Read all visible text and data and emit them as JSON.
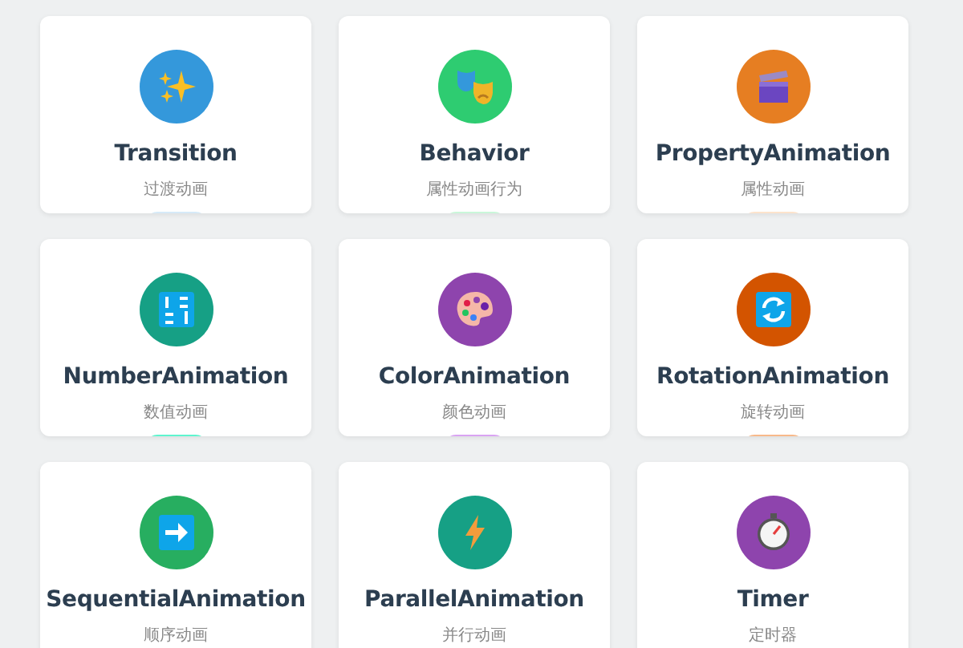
{
  "cards": [
    {
      "kind": "sparkles",
      "color": "#3498db",
      "title": "Transition",
      "subtitle": "过渡动画",
      "tag": {
        "color": "#d6eaf8"
      }
    },
    {
      "kind": "masks",
      "color": "#2ecc71",
      "title": "Behavior",
      "subtitle": "属性动画行为",
      "tag": {
        "color": "#c9f7d9"
      }
    },
    {
      "kind": "clapper",
      "color": "#e67e22",
      "title": "PropertyAnimation",
      "subtitle": "属性动画",
      "tag": {
        "color": "#fde3cc"
      }
    },
    {
      "kind": "numbers",
      "color": "#16a085",
      "title": "NumberAnimation",
      "subtitle": "数值动画",
      "tag": {
        "color": "#5ff5cf"
      }
    },
    {
      "kind": "palette",
      "color": "#8e44ad",
      "title": "ColorAnimation",
      "subtitle": "颜色动画",
      "tag": {
        "color": "#d9a3f2"
      }
    },
    {
      "kind": "rotate",
      "color": "#d35400",
      "title": "RotationAnimation",
      "subtitle": "旋转动画",
      "tag": {
        "color": "#f7b98a"
      }
    },
    {
      "kind": "arrow",
      "color": "#27ae60",
      "title": "SequentialAnimation",
      "subtitle": "顺序动画"
    },
    {
      "kind": "bolt",
      "color": "#16a085",
      "title": "ParallelAnimation",
      "subtitle": "并行动画"
    },
    {
      "kind": "stopwatch",
      "color": "#8e44ad",
      "title": "Timer",
      "subtitle": "定时器"
    }
  ]
}
